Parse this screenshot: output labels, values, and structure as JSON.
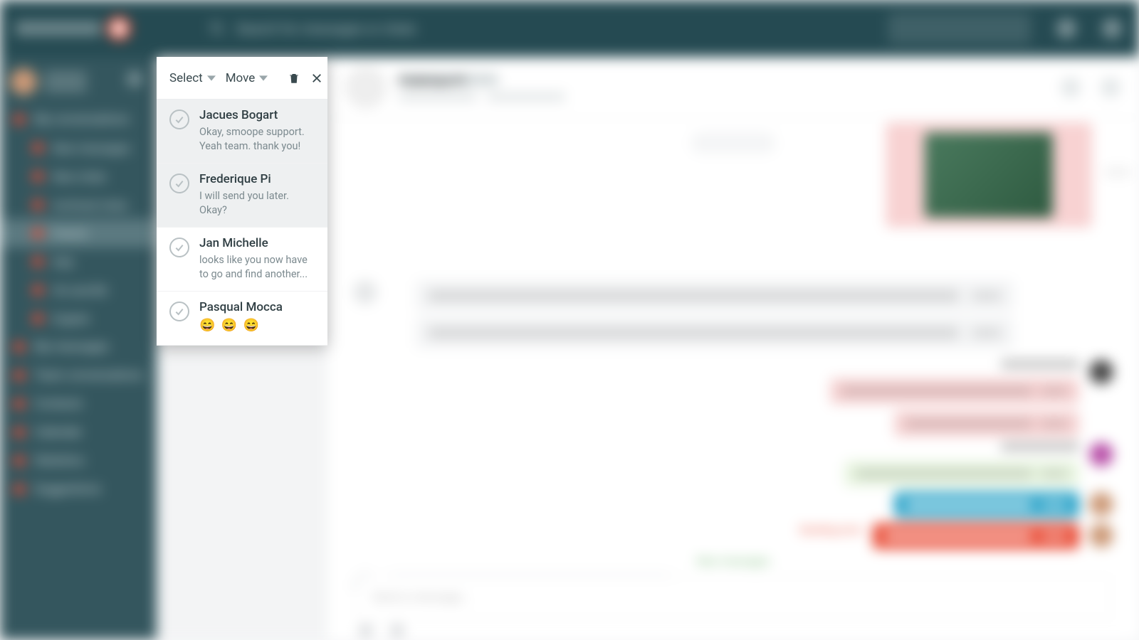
{
  "header": {
    "search_placeholder": "Search for messages or chats"
  },
  "sidebar": {
    "items": [
      {
        "label": "My conversations",
        "sub": false,
        "sel": false
      },
      {
        "label": "New messages",
        "sub": true,
        "sel": false
      },
      {
        "label": "New chats",
        "sub": true,
        "sel": false
      },
      {
        "label": "Archived chats",
        "sub": true,
        "sel": false
      },
      {
        "label": "French",
        "sub": true,
        "sel": true
      },
      {
        "label": "Italy",
        "sub": true,
        "sel": false
      },
      {
        "label": "HU and BG",
        "sub": true,
        "sel": false
      },
      {
        "label": "English",
        "sub": true,
        "sel": false
      },
      {
        "label": "My messages",
        "sub": false,
        "sel": false
      },
      {
        "label": "Team conversations",
        "sub": false,
        "sel": false
      },
      {
        "label": "Contacts",
        "sub": false,
        "sel": false
      },
      {
        "label": "Calendar",
        "sub": false,
        "sel": false
      },
      {
        "label": "Statistics",
        "sub": false,
        "sel": false
      },
      {
        "label": "Suggestions",
        "sub": false,
        "sel": false
      }
    ]
  },
  "panel": {
    "toolbar": {
      "select_label": "Select",
      "move_label": "Move"
    },
    "rows": [
      {
        "name": "Jacues Bogart",
        "preview": "Okay, smoope support. Yeah team. thank you!",
        "selected": true
      },
      {
        "name": "Frederique Pi",
        "preview": "I will send you later. Okay?",
        "selected": true
      },
      {
        "name": "Jan Michelle",
        "preview": "looks like you now have to go and find another...",
        "selected": false
      },
      {
        "name": "Pasqual Mocca",
        "preview": "😄 😄 😄",
        "selected": false
      }
    ]
  },
  "chat": {
    "title": "Frederique Pi",
    "input_placeholder": "Send a message…",
    "divider": "New messages"
  }
}
